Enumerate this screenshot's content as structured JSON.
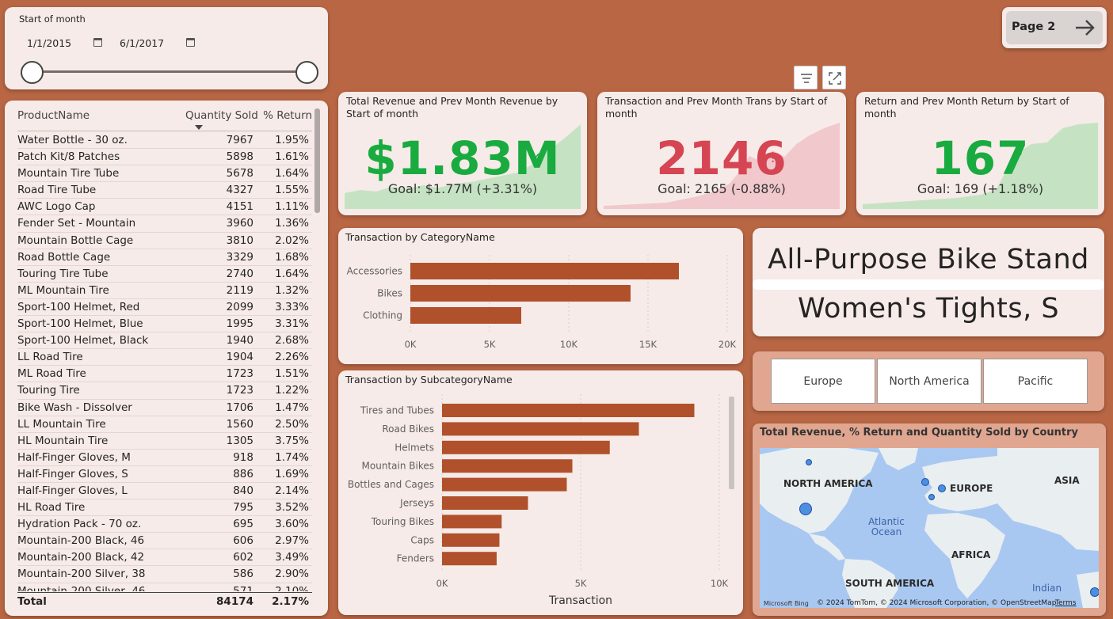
{
  "slicer": {
    "label": "Start of month",
    "start": "1/1/2015",
    "end": "6/1/2017"
  },
  "table": {
    "headers": [
      "ProductName",
      "Quantity Sold",
      "% Return"
    ],
    "rows": [
      [
        "Water Bottle - 30 oz.",
        "7967",
        "1.95%"
      ],
      [
        "Patch Kit/8 Patches",
        "5898",
        "1.61%"
      ],
      [
        "Mountain Tire Tube",
        "5678",
        "1.64%"
      ],
      [
        "Road Tire Tube",
        "4327",
        "1.55%"
      ],
      [
        "AWC Logo Cap",
        "4151",
        "1.11%"
      ],
      [
        "Fender Set - Mountain",
        "3960",
        "1.36%"
      ],
      [
        "Mountain Bottle Cage",
        "3810",
        "2.02%"
      ],
      [
        "Road Bottle Cage",
        "3329",
        "1.68%"
      ],
      [
        "Touring Tire Tube",
        "2740",
        "1.64%"
      ],
      [
        "ML Mountain Tire",
        "2119",
        "1.32%"
      ],
      [
        "Sport-100 Helmet, Red",
        "2099",
        "3.33%"
      ],
      [
        "Sport-100 Helmet, Blue",
        "1995",
        "3.31%"
      ],
      [
        "Sport-100 Helmet, Black",
        "1940",
        "2.68%"
      ],
      [
        "LL Road Tire",
        "1904",
        "2.26%"
      ],
      [
        "ML Road Tire",
        "1723",
        "1.51%"
      ],
      [
        "Touring Tire",
        "1723",
        "1.22%"
      ],
      [
        "Bike Wash - Dissolver",
        "1706",
        "1.47%"
      ],
      [
        "LL Mountain Tire",
        "1560",
        "2.50%"
      ],
      [
        "HL Mountain Tire",
        "1305",
        "3.75%"
      ],
      [
        "Half-Finger Gloves, M",
        "918",
        "1.74%"
      ],
      [
        "Half-Finger Gloves, S",
        "886",
        "1.69%"
      ],
      [
        "Half-Finger Gloves, L",
        "840",
        "2.14%"
      ],
      [
        "HL Road Tire",
        "795",
        "3.52%"
      ],
      [
        "Hydration Pack - 70 oz.",
        "695",
        "3.60%"
      ],
      [
        "Mountain-200 Black, 46",
        "606",
        "2.97%"
      ],
      [
        "Mountain-200 Black, 42",
        "602",
        "3.49%"
      ],
      [
        "Mountain-200 Silver, 38",
        "586",
        "2.90%"
      ],
      [
        "Mountain-200 Silver, 46",
        "571",
        "2.10%"
      ]
    ],
    "total": [
      "Total",
      "84174",
      "2.17%"
    ]
  },
  "kpis": [
    {
      "title": "Total Revenue and Prev Month Revenue by Start of month",
      "value": "$1.83M",
      "goal": "Goal: $1.77M (+3.31%)",
      "mark": "✓",
      "color": "#1aab40"
    },
    {
      "title": "Transaction and Prev Month Trans by Start of month",
      "value": "2146",
      "goal": "Goal: 2165 (-0.88%)",
      "mark": "!",
      "color": "#d64554"
    },
    {
      "title": "Return and Prev Month Return by Start of month",
      "value": "167",
      "goal": "Goal: 169 (+1.18%)",
      "mark": "✓",
      "color": "#1aab40"
    }
  ],
  "page_button": {
    "label": "Page 2"
  },
  "cards": {
    "top": "All-Purpose Bike Stand",
    "bottom": "Women's Tights, S"
  },
  "regions": [
    "Europe",
    "North America",
    "Pacific"
  ],
  "map": {
    "title": "Total Revenue, % Return and Quantity Sold by Country",
    "labels": {
      "na": "NORTH AMERICA",
      "eu": "EUROPE",
      "asia": "ASIA",
      "africa": "AFRICA",
      "sa": "SOUTH AMERICA"
    },
    "oceans": {
      "atlantic": "Atlantic Ocean",
      "indian": "Indian"
    },
    "attribution": "© 2024 TomTom, © 2024 Microsoft Corporation, © OpenStreetMap",
    "terms": "Terms",
    "logo": "Microsoft Bing"
  },
  "chart_data": [
    {
      "type": "bar",
      "title": "Transaction by CategoryName",
      "categories": [
        "Accessories",
        "Bikes",
        "Clothing"
      ],
      "values": [
        16950,
        13900,
        7000
      ],
      "xlim": [
        0,
        20000
      ],
      "ticks": [
        "0K",
        "5K",
        "10K",
        "15K",
        "20K"
      ],
      "bar_color": "#b0512b"
    },
    {
      "type": "bar",
      "title": "Transaction by SubcategoryName",
      "categories": [
        "Tires and Tubes",
        "Road Bikes",
        "Helmets",
        "Mountain Bikes",
        "Bottles and Cages",
        "Jerseys",
        "Touring Bikes",
        "Caps",
        "Fenders"
      ],
      "values": [
        9100,
        7100,
        6050,
        4700,
        4500,
        3100,
        2150,
        2070,
        1970
      ],
      "xlim": [
        0,
        10000
      ],
      "ticks": [
        "0K",
        "5K",
        "10K"
      ],
      "xlabel": "Transaction",
      "bar_color": "#b0512b"
    }
  ]
}
